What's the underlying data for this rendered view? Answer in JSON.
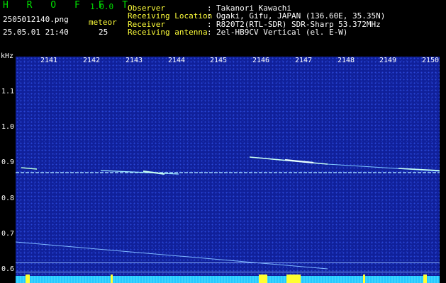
{
  "header": {
    "app_title": "H R O F F T",
    "version": "1.0.0",
    "filename": "2505012140.png",
    "datetime": "25.05.01 21:40",
    "meteor_label": "meteor",
    "meteor_count": "25",
    "info": [
      {
        "label": "Observer",
        "sep": ":",
        "value": "Takanori Kawachi"
      },
      {
        "label": "Receiving Location",
        "sep": ":",
        "value": "Ogaki, Gifu, JAPAN (136.60E, 35.35N)"
      },
      {
        "label": "Receiver",
        "sep": ":",
        "value": "R820T2(RTL-SDR) SDR-Sharp 53.372MHz"
      },
      {
        "label": "Receiving antenna",
        "sep": ":",
        "value": "2el-HB9CV Vertical (el. E-W)"
      }
    ]
  },
  "axis": {
    "y_unit": "kHz",
    "y_ticks": [
      "1.1",
      "1.0",
      "0.9",
      "0.8",
      "0.7",
      "0.6"
    ],
    "x_ticks": [
      "2141",
      "2142",
      "2143",
      "2144",
      "2145",
      "2146",
      "2147",
      "2148",
      "2149",
      "2150"
    ]
  },
  "colors": {
    "background": "#000000",
    "spectrogram": "#10209a",
    "title": "#00e000",
    "marker": "#ffff30"
  }
}
